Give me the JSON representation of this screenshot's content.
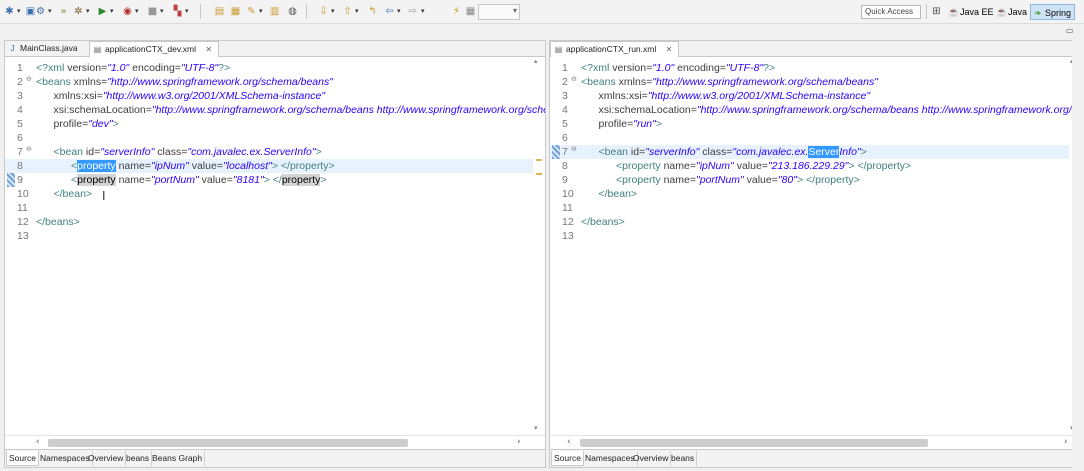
{
  "toolbar": {
    "quick_access": "Quick Access",
    "perspectives": [
      {
        "label": "Java EE",
        "icon": "java-ee-perspective-icon"
      },
      {
        "label": "Java",
        "icon": "java-perspective-icon"
      },
      {
        "label": "Spring",
        "icon": "spring-perspective-icon",
        "active": true
      }
    ]
  },
  "left_editor": {
    "tabs": [
      {
        "label": "MainClass.java",
        "active": false
      },
      {
        "label": "applicationCTX_dev.xml",
        "active": true
      }
    ],
    "lines": [
      {
        "n": "1",
        "t": [
          [
            "pi-t",
            "<?xml "
          ],
          [
            "attr",
            "version="
          ],
          [
            "val",
            "\"1.0\""
          ],
          [
            "attr",
            " encoding="
          ],
          [
            "val",
            "\"UTF-8\""
          ],
          [
            "pi-t",
            "?>"
          ]
        ]
      },
      {
        "n": "2",
        "fold": true,
        "t": [
          [
            "tag",
            "<beans "
          ],
          [
            "attr",
            "xmlns="
          ],
          [
            "val",
            "\"http://www.springframework.org/schema/beans\""
          ]
        ]
      },
      {
        "n": "3",
        "t": [
          [
            "attr",
            "      xmlns:xsi="
          ],
          [
            "val",
            "\"http://www.w3.org/2001/XMLSchema-instance\""
          ]
        ]
      },
      {
        "n": "4",
        "t": [
          [
            "attr",
            "      xsi:schemaLocation="
          ],
          [
            "val",
            "\"http://www.springframework.org/schema/beans http://www.springframework.org/schema/beans/spring-beans.xsd\""
          ]
        ]
      },
      {
        "n": "5",
        "t": [
          [
            "attr",
            "      profile="
          ],
          [
            "val",
            "\"dev\""
          ],
          [
            "tag",
            ">"
          ]
        ]
      },
      {
        "n": "6",
        "t": []
      },
      {
        "n": "7",
        "fold": true,
        "t": [
          [
            "tag",
            "      <bean "
          ],
          [
            "attr",
            "id="
          ],
          [
            "val",
            "\"serverInfo\""
          ],
          [
            "attr",
            " class="
          ],
          [
            "val",
            "\"com.javalec.ex.ServerInfo\""
          ],
          [
            "tag",
            ">"
          ]
        ]
      },
      {
        "n": "8",
        "current": true,
        "t": [
          [
            "tag",
            "            <"
          ],
          [
            "sel",
            "property"
          ],
          [
            "attr",
            " name="
          ],
          [
            "val",
            "\"ipNum\""
          ],
          [
            "attr",
            " value="
          ],
          [
            "val",
            "\"localhost\""
          ],
          [
            "tag",
            "> </property>"
          ]
        ]
      },
      {
        "n": "9",
        "mark": true,
        "t": [
          [
            "tag",
            "            <"
          ],
          [
            "occ",
            "property"
          ],
          [
            "attr",
            " name="
          ],
          [
            "val",
            "\"portNum\""
          ],
          [
            "attr",
            " value="
          ],
          [
            "val",
            "\"8181\""
          ],
          [
            "tag",
            "> </"
          ],
          [
            "occ",
            "property"
          ],
          [
            "tag",
            ">"
          ]
        ]
      },
      {
        "n": "10",
        "t": [
          [
            "tag",
            "      </bean>"
          ]
        ]
      },
      {
        "n": "11",
        "t": []
      },
      {
        "n": "12",
        "t": [
          [
            "tag",
            "</beans>"
          ]
        ]
      },
      {
        "n": "13",
        "t": []
      }
    ],
    "bottom_tabs": [
      "Source",
      "Namespaces",
      "Overview",
      "beans",
      "Beans Graph"
    ]
  },
  "right_editor": {
    "tabs": [
      {
        "label": "applicationCTX_run.xml",
        "active": true
      }
    ],
    "lines": [
      {
        "n": "1",
        "t": [
          [
            "pi-t",
            "<?xml "
          ],
          [
            "attr",
            "version="
          ],
          [
            "val",
            "\"1.0\""
          ],
          [
            "attr",
            " encoding="
          ],
          [
            "val",
            "\"UTF-8\""
          ],
          [
            "pi-t",
            "?>"
          ]
        ]
      },
      {
        "n": "2",
        "fold": true,
        "t": [
          [
            "tag",
            "<beans "
          ],
          [
            "attr",
            "xmlns="
          ],
          [
            "val",
            "\"http://www.springframework.org/schema/beans\""
          ]
        ]
      },
      {
        "n": "3",
        "t": [
          [
            "attr",
            "      xmlns:xsi="
          ],
          [
            "val",
            "\"http://www.w3.org/2001/XMLSchema-instance\""
          ]
        ]
      },
      {
        "n": "4",
        "t": [
          [
            "attr",
            "      xsi:schemaLocation="
          ],
          [
            "val",
            "\"http://www.springframework.org/schema/beans http://www.springframework.org/schema/beans/spring-beans.xsd\""
          ]
        ]
      },
      {
        "n": "5",
        "t": [
          [
            "attr",
            "      profile="
          ],
          [
            "val",
            "\"run\""
          ],
          [
            "tag",
            ">"
          ]
        ]
      },
      {
        "n": "6",
        "t": []
      },
      {
        "n": "7",
        "fold": true,
        "current": true,
        "mark": true,
        "t": [
          [
            "tag",
            "      <bean "
          ],
          [
            "attr",
            "id="
          ],
          [
            "val",
            "\"serverInfo\""
          ],
          [
            "attr",
            " class="
          ],
          [
            "val",
            "\"com.javalec.ex."
          ],
          [
            "sel",
            "Server"
          ],
          [
            "val",
            "Info\""
          ],
          [
            "tag",
            ">"
          ]
        ]
      },
      {
        "n": "8",
        "t": [
          [
            "tag",
            "            <property "
          ],
          [
            "attr",
            "name="
          ],
          [
            "val",
            "\"ipNum\""
          ],
          [
            "attr",
            " value="
          ],
          [
            "val",
            "\"213.186.229.29\""
          ],
          [
            "tag",
            "> </property>"
          ]
        ]
      },
      {
        "n": "9",
        "t": [
          [
            "tag",
            "            <property "
          ],
          [
            "attr",
            "name="
          ],
          [
            "val",
            "\"portNum\""
          ],
          [
            "attr",
            " value="
          ],
          [
            "val",
            "\"80\""
          ],
          [
            "tag",
            "> </property>"
          ]
        ]
      },
      {
        "n": "10",
        "t": [
          [
            "tag",
            "      </bean>"
          ]
        ]
      },
      {
        "n": "11",
        "t": []
      },
      {
        "n": "12",
        "t": [
          [
            "tag",
            "</beans>"
          ]
        ]
      },
      {
        "n": "13",
        "t": []
      }
    ],
    "bottom_tabs": [
      "Source",
      "Namespaces",
      "Overview",
      "beans"
    ]
  }
}
